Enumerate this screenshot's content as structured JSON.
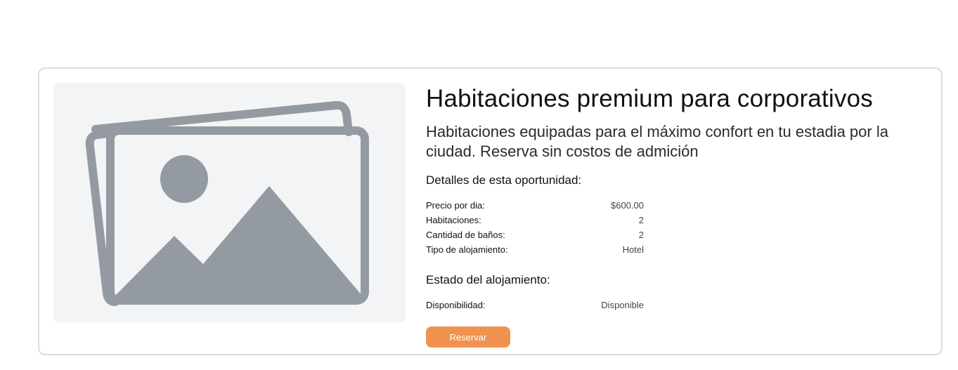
{
  "listing": {
    "title": "Habitaciones premium para corporativos",
    "description": "Habitaciones equipadas para el máximo confort en tu estadia por la ciudad. Reserva sin costos de admición",
    "image_icon": "image-placeholder-icon",
    "details_heading": "Detalles de esta oportunidad:",
    "details": [
      {
        "label": "Precio por dia:",
        "value": "$600.00"
      },
      {
        "label": "Habitaciones:",
        "value": "2"
      },
      {
        "label": "Cantidad de baños:",
        "value": "2"
      },
      {
        "label": "Tipo de alojamiento:",
        "value": "Hotel"
      }
    ],
    "status_heading": "Estado del alojamiento:",
    "status": [
      {
        "label": "Disponibilidad:",
        "value": "Disponible"
      }
    ],
    "reserve_label": "Reservar"
  },
  "colors": {
    "accent": "#f0924f",
    "placeholder_bg": "#f3f4f6",
    "placeholder_icon": "#949aa1",
    "card_border": "#dcdcdc"
  }
}
